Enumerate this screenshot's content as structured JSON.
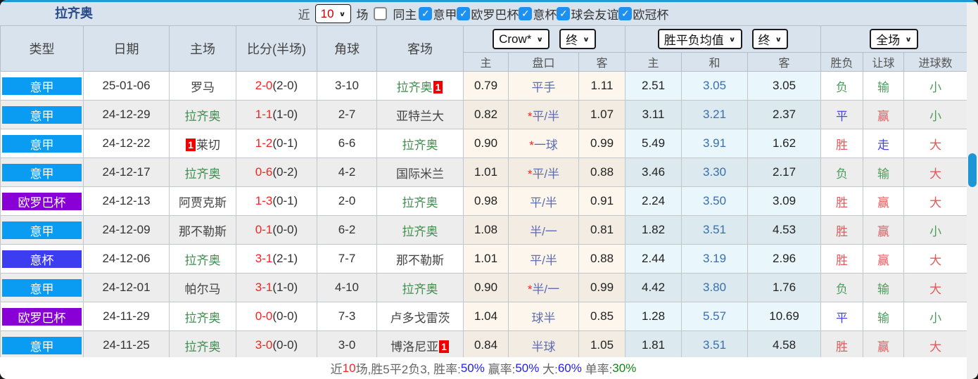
{
  "title": "拉齐奥",
  "topbar": {
    "near_label": "近",
    "near_value": "10",
    "matches_label": "场",
    "same_home_label": "同主",
    "same_home_checked": false,
    "leagues": [
      {
        "label": "意甲",
        "checked": true
      },
      {
        "label": "欧罗巴杯",
        "checked": true
      },
      {
        "label": "意杯",
        "checked": true
      },
      {
        "label": "球会友谊",
        "checked": true
      },
      {
        "label": "欧冠杯",
        "checked": true
      }
    ]
  },
  "header": {
    "col_type": "类型",
    "col_date": "日期",
    "col_home": "主场",
    "col_score": "比分(半场)",
    "col_corner": "角球",
    "col_away": "客场",
    "odds_select": "Crow*",
    "odds_final_select": "终",
    "avg_select": "胜平负均值",
    "avg_final_select": "终",
    "period_select": "全场",
    "sub": {
      "home": "主",
      "handicap": "盘口",
      "away": "客",
      "avg_home": "主",
      "avg_draw": "和",
      "avg_away": "客",
      "result": "胜负",
      "let_goal": "让球",
      "goals": "进球数"
    }
  },
  "colors": {
    "accent_line": "#1e9cd7",
    "panel_bg": "#d9e3ed",
    "title": "#2b4a8b",
    "checkbox_on": "#1e90f0",
    "near_value_red": "#cc0000",
    "type_seriea": "#0a9bf2",
    "type_coppa": "#3c3cf0",
    "type_europa": "#8800d5",
    "team_green": "#3f8e4f",
    "team_dark": "#444444",
    "score_red": "#ff2020",
    "half_dark": "#333333",
    "handicap": "#5d6dae",
    "star_red": "#ff2020",
    "avg_draw_blue": "#3a6fae",
    "win_red": "#e25b5b",
    "draw_blue": "#4646e8",
    "lose_green": "#4d9d5c",
    "badge_red": "#ee0000",
    "scroll_thumb": "#1e96d5",
    "footer_gray": "#666666",
    "footer_blue": "#2222ee",
    "footer_green": "#118811",
    "footer_red": "#ff2222"
  },
  "table": {
    "rows": [
      {
        "type": "意甲",
        "type_key": "seriea",
        "date": "25-01-06",
        "home": "罗马",
        "home_green": false,
        "home_badge": "",
        "score": "2-0",
        "half": "(2-0)",
        "corner": "3-10",
        "away": "拉齐奥",
        "away_green": true,
        "away_badge": "1",
        "o1": "0.79",
        "star": false,
        "hc": "平手",
        "o2": "1.11",
        "a1": "2.51",
        "a2": "3.05",
        "a3": "3.05",
        "res": "负",
        "res_key": "lose",
        "let": "输",
        "let_key": "lose",
        "goal": "小",
        "goal_key": "small"
      },
      {
        "type": "意甲",
        "type_key": "seriea",
        "date": "24-12-29",
        "home": "拉齐奥",
        "home_green": true,
        "home_badge": "",
        "score": "1-1",
        "half": "(1-0)",
        "corner": "2-7",
        "away": "亚特兰大",
        "away_green": false,
        "away_badge": "",
        "o1": "0.82",
        "star": true,
        "hc": "平/半",
        "o2": "1.07",
        "a1": "3.11",
        "a2": "3.21",
        "a3": "2.37",
        "res": "平",
        "res_key": "draw",
        "let": "赢",
        "let_key": "win",
        "goal": "小",
        "goal_key": "small"
      },
      {
        "type": "意甲",
        "type_key": "seriea",
        "date": "24-12-22",
        "home": "莱切",
        "home_green": false,
        "home_badge": "1",
        "score": "1-2",
        "half": "(0-1)",
        "corner": "6-6",
        "away": "拉齐奥",
        "away_green": true,
        "away_badge": "",
        "o1": "0.90",
        "star": true,
        "hc": "一球",
        "o2": "0.99",
        "a1": "5.49",
        "a2": "3.91",
        "a3": "1.62",
        "res": "胜",
        "res_key": "win",
        "let": "走",
        "let_key": "draw",
        "goal": "大",
        "goal_key": "big"
      },
      {
        "type": "意甲",
        "type_key": "seriea",
        "date": "24-12-17",
        "home": "拉齐奥",
        "home_green": true,
        "home_badge": "",
        "score": "0-6",
        "half": "(0-2)",
        "corner": "4-2",
        "away": "国际米兰",
        "away_green": false,
        "away_badge": "",
        "o1": "1.01",
        "star": true,
        "hc": "平/半",
        "o2": "0.88",
        "a1": "3.46",
        "a2": "3.30",
        "a3": "2.17",
        "res": "负",
        "res_key": "lose",
        "let": "输",
        "let_key": "lose",
        "goal": "大",
        "goal_key": "big"
      },
      {
        "type": "欧罗巴杯",
        "type_key": "europa",
        "date": "24-12-13",
        "home": "阿贾克斯",
        "home_green": false,
        "home_badge": "",
        "score": "1-3",
        "half": "(0-1)",
        "corner": "2-0",
        "away": "拉齐奥",
        "away_green": true,
        "away_badge": "",
        "o1": "0.98",
        "star": false,
        "hc": "平/半",
        "o2": "0.91",
        "a1": "2.24",
        "a2": "3.50",
        "a3": "3.09",
        "res": "胜",
        "res_key": "win",
        "let": "赢",
        "let_key": "win",
        "goal": "大",
        "goal_key": "big"
      },
      {
        "type": "意甲",
        "type_key": "seriea",
        "date": "24-12-09",
        "home": "那不勒斯",
        "home_green": false,
        "home_badge": "",
        "score": "0-1",
        "half": "(0-0)",
        "corner": "6-2",
        "away": "拉齐奥",
        "away_green": true,
        "away_badge": "",
        "o1": "1.08",
        "star": false,
        "hc": "半/一",
        "o2": "0.81",
        "a1": "1.82",
        "a2": "3.51",
        "a3": "4.53",
        "res": "胜",
        "res_key": "win",
        "let": "赢",
        "let_key": "win",
        "goal": "小",
        "goal_key": "small"
      },
      {
        "type": "意杯",
        "type_key": "coppa",
        "date": "24-12-06",
        "home": "拉齐奥",
        "home_green": true,
        "home_badge": "",
        "score": "3-1",
        "half": "(2-1)",
        "corner": "7-7",
        "away": "那不勒斯",
        "away_green": false,
        "away_badge": "",
        "o1": "1.01",
        "star": false,
        "hc": "平/半",
        "o2": "0.88",
        "a1": "2.44",
        "a2": "3.19",
        "a3": "2.96",
        "res": "胜",
        "res_key": "win",
        "let": "赢",
        "let_key": "win",
        "goal": "大",
        "goal_key": "big"
      },
      {
        "type": "意甲",
        "type_key": "seriea",
        "date": "24-12-01",
        "home": "帕尔马",
        "home_green": false,
        "home_badge": "",
        "score": "3-1",
        "half": "(1-0)",
        "corner": "4-10",
        "away": "拉齐奥",
        "away_green": true,
        "away_badge": "",
        "o1": "0.90",
        "star": true,
        "hc": "半/一",
        "o2": "0.99",
        "a1": "4.42",
        "a2": "3.80",
        "a3": "1.76",
        "res": "负",
        "res_key": "lose",
        "let": "输",
        "let_key": "lose",
        "goal": "大",
        "goal_key": "big"
      },
      {
        "type": "欧罗巴杯",
        "type_key": "europa",
        "date": "24-11-29",
        "home": "拉齐奥",
        "home_green": true,
        "home_badge": "",
        "score": "0-0",
        "half": "(0-0)",
        "corner": "7-3",
        "away": "卢多戈雷茨",
        "away_green": false,
        "away_badge": "",
        "o1": "1.04",
        "star": false,
        "hc": "球半",
        "o2": "0.85",
        "a1": "1.28",
        "a2": "5.57",
        "a3": "10.69",
        "res": "平",
        "res_key": "draw",
        "let": "输",
        "let_key": "lose",
        "goal": "小",
        "goal_key": "small"
      },
      {
        "type": "意甲",
        "type_key": "seriea",
        "date": "24-11-25",
        "home": "拉齐奥",
        "home_green": true,
        "home_badge": "",
        "score": "3-0",
        "half": "(0-0)",
        "corner": "3-0",
        "away": "博洛尼亚",
        "away_green": false,
        "away_badge": "1",
        "o1": "0.84",
        "star": false,
        "hc": "半球",
        "o2": "1.05",
        "a1": "1.81",
        "a2": "3.51",
        "a3": "4.58",
        "res": "胜",
        "res_key": "win",
        "let": "赢",
        "let_key": "win",
        "goal": "大",
        "goal_key": "big"
      }
    ]
  },
  "footer_segments": [
    {
      "text": "近",
      "key": "gray"
    },
    {
      "text": "10",
      "key": "red"
    },
    {
      "text": "场,胜5平2负3, 胜率:",
      "key": "gray"
    },
    {
      "text": "50%",
      "key": "blue"
    },
    {
      "text": " 赢率:",
      "key": "gray"
    },
    {
      "text": "50%",
      "key": "blue"
    },
    {
      "text": " 大:",
      "key": "gray"
    },
    {
      "text": "60%",
      "key": "blue"
    },
    {
      "text": " 单率:",
      "key": "gray"
    },
    {
      "text": "30%",
      "key": "green"
    }
  ]
}
